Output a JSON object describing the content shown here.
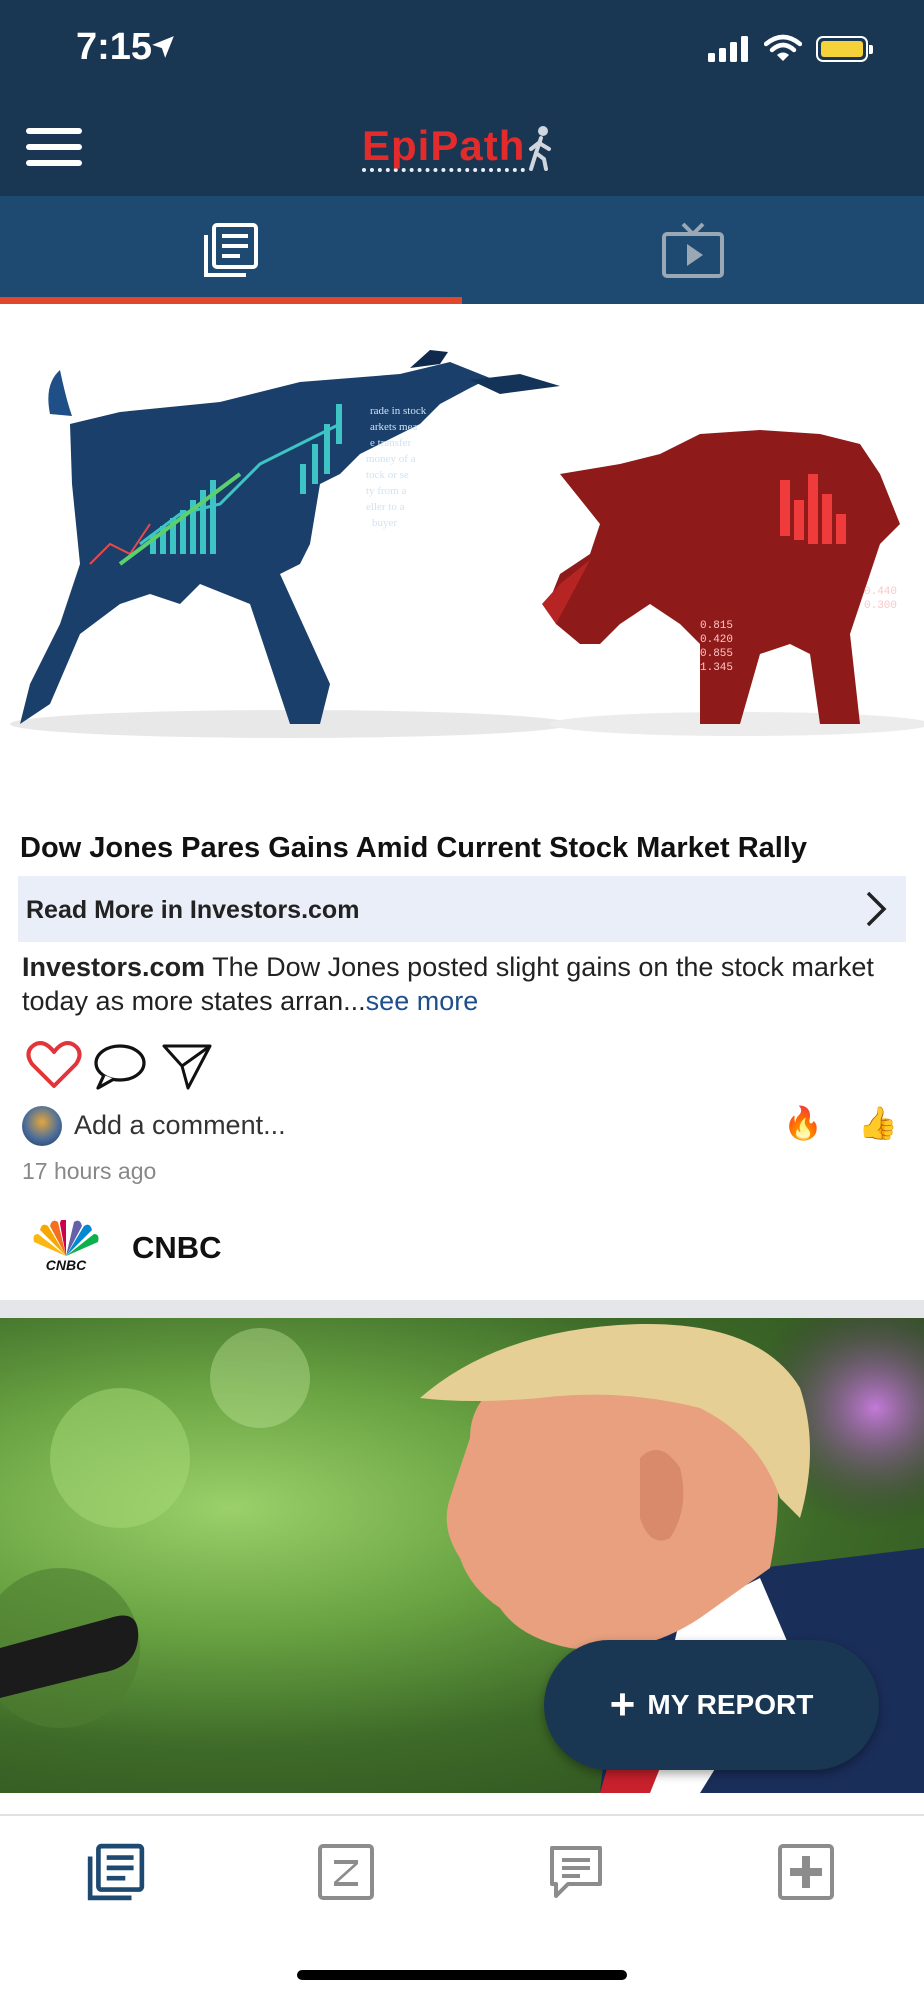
{
  "status": {
    "time": "7:15"
  },
  "app": {
    "title": "EpiPath"
  },
  "tabs": [
    {
      "name": "News"
    },
    {
      "name": "Video"
    }
  ],
  "article": {
    "headline": "Dow Jones Pares Gains Amid Current Stock Market Rally",
    "read_more": "Read More in  Investors.com",
    "description_source": "Investors.com",
    "description_text": " The Dow Jones posted slight gains on the stock market today as more states arran...",
    "see_more": "see more",
    "comment_placeholder": "Add a comment...",
    "reactions": [
      "🔥",
      "👍"
    ],
    "time_ago": "17 hours ago"
  },
  "next_article": {
    "source_logo_text": "CNBC",
    "source_name": "CNBC"
  },
  "fab": {
    "label": "MY REPORT"
  },
  "colors": {
    "primary": "#193652",
    "tabbar": "#1e4a71",
    "accent_red": "#e0472d",
    "logo_red": "#e32b2b",
    "link": "#1f4e8c"
  }
}
